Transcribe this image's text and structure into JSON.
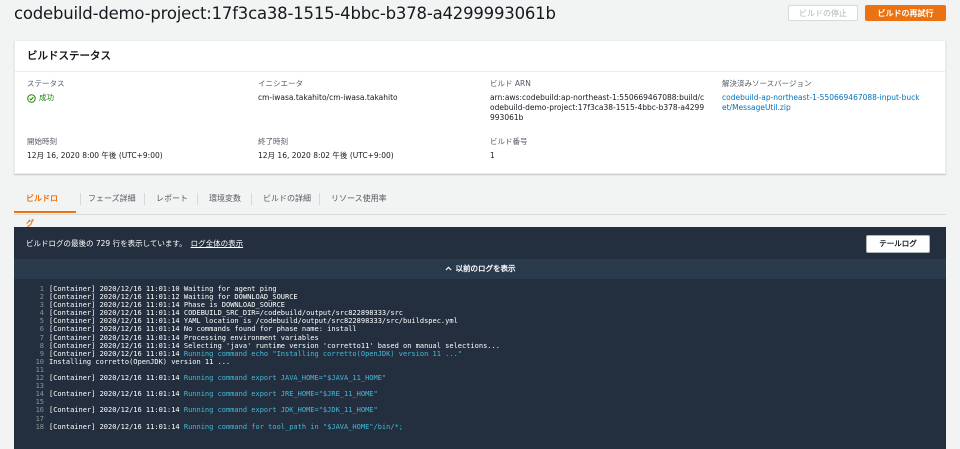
{
  "header": {
    "title": "codebuild-demo-project:17f3ca38-1515-4bbc-b378-a4299993061b",
    "stop_button": "ビルドの停止",
    "retry_button": "ビルドの再試行"
  },
  "status_panel": {
    "title": "ビルドステータス",
    "fields": {
      "status": {
        "label": "ステータス",
        "value": "成功"
      },
      "initiator": {
        "label": "イニシエータ",
        "value": "cm-iwasa.takahito/cm-iwasa.takahito"
      },
      "arn": {
        "label": "ビルド ARN",
        "value": "arn:aws:codebuild:ap-northeast-1:550669467088:build/codebuild-demo-project:17f3ca38-1515-4bbc-b378-a4299993061b"
      },
      "source_version": {
        "label": "解決済みソースバージョン",
        "value": "codebuild-ap-northeast-1-550669467088-input-bucket/MessageUtil.zip"
      },
      "start_time": {
        "label": "開始時刻",
        "value": "12月 16, 2020 8:00 午後 (UTC+9:00)"
      },
      "end_time": {
        "label": "終了時刻",
        "value": "12月 16, 2020 8:02 午後 (UTC+9:00)"
      },
      "build_number": {
        "label": "ビルド番号",
        "value": "1"
      }
    }
  },
  "tabs": [
    "ビルドログ",
    "フェーズ詳細",
    "レポート",
    "環境変数",
    "ビルドの詳細",
    "リソース使用率"
  ],
  "log": {
    "info_text": "ビルドログの最後の 729 行を表示しています。",
    "full_log_link": "ログ全体の表示",
    "tail_button": "テールログ",
    "previous_logs": "以前のログを表示",
    "lines": [
      {
        "n": "1",
        "text": "[Container] 2020/12/16 11:01:10 Waiting for agent ping",
        "cmd": ""
      },
      {
        "n": "2",
        "text": "[Container] 2020/12/16 11:01:12 Waiting for DOWNLOAD_SOURCE",
        "cmd": ""
      },
      {
        "n": "3",
        "text": "[Container] 2020/12/16 11:01:14 Phase is DOWNLOAD_SOURCE",
        "cmd": ""
      },
      {
        "n": "4",
        "text": "[Container] 2020/12/16 11:01:14 CODEBUILD_SRC_DIR=/codebuild/output/src822898333/src",
        "cmd": ""
      },
      {
        "n": "5",
        "text": "[Container] 2020/12/16 11:01:14 YAML location is /codebuild/output/src822898333/src/buildspec.yml",
        "cmd": ""
      },
      {
        "n": "6",
        "text": "[Container] 2020/12/16 11:01:14 No commands found for phase name: install",
        "cmd": ""
      },
      {
        "n": "7",
        "text": "[Container] 2020/12/16 11:01:14 Processing environment variables",
        "cmd": ""
      },
      {
        "n": "8",
        "text": "[Container] 2020/12/16 11:01:14 Selecting 'java' runtime version 'corretto11' based on manual selections...",
        "cmd": ""
      },
      {
        "n": "9",
        "text": "[Container] 2020/12/16 11:01:14 ",
        "cmd": "Running command echo \"Installing corretto(OpenJDK) version 11 ...\""
      },
      {
        "n": "10",
        "text": "Installing corretto(OpenJDK) version 11 ...",
        "cmd": ""
      },
      {
        "n": "11",
        "text": "",
        "cmd": ""
      },
      {
        "n": "12",
        "text": "[Container] 2020/12/16 11:01:14 ",
        "cmd": "Running command export JAVA_HOME=\"$JAVA_11_HOME\""
      },
      {
        "n": "13",
        "text": "",
        "cmd": ""
      },
      {
        "n": "14",
        "text": "[Container] 2020/12/16 11:01:14 ",
        "cmd": "Running command export JRE_HOME=\"$JRE_11_HOME\""
      },
      {
        "n": "15",
        "text": "",
        "cmd": ""
      },
      {
        "n": "16",
        "text": "[Container] 2020/12/16 11:01:14 ",
        "cmd": "Running command export JDK_HOME=\"$JDK_11_HOME\""
      },
      {
        "n": "17",
        "text": "",
        "cmd": ""
      },
      {
        "n": "18",
        "text": "[Container] 2020/12/16 11:01:14 ",
        "cmd": "Running command for tool_path in \"$JAVA_HOME\"/bin/*;"
      }
    ]
  }
}
